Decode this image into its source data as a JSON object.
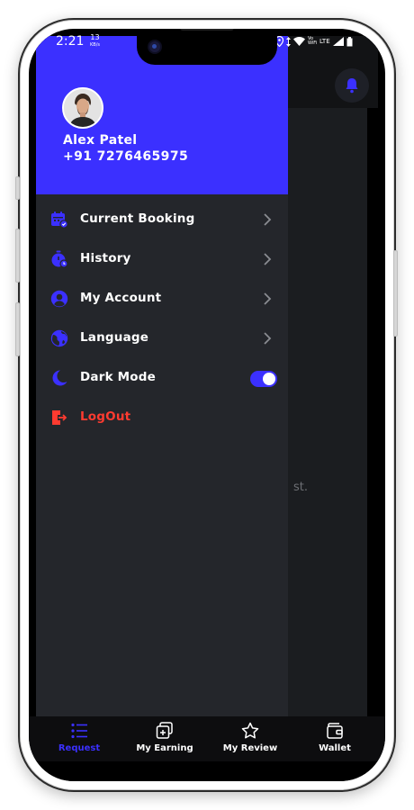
{
  "status_bar": {
    "time": "2:21",
    "net_speed": "13",
    "net_unit": "KB/s",
    "network_type": "LTE",
    "wifi_label": "Vo WiFi"
  },
  "drawer": {
    "user": {
      "name": "Alex Patel",
      "phone": "+91 7276465975"
    },
    "menu": [
      {
        "label": "Current Booking",
        "icon": "calendar-icon"
      },
      {
        "label": "History",
        "icon": "stopwatch-icon"
      },
      {
        "label": "My Account",
        "icon": "user-circle-icon"
      },
      {
        "label": "Language",
        "icon": "globe-icon"
      },
      {
        "label": "Dark Mode",
        "icon": "moon-icon",
        "toggle_on": true
      },
      {
        "label": "LogOut",
        "icon": "logout-icon"
      }
    ]
  },
  "background_screen": {
    "partial_text": "st."
  },
  "bottom_nav": {
    "items": [
      {
        "label": "Request",
        "icon": "list-icon",
        "active": true
      },
      {
        "label": "My Earning",
        "icon": "cards-icon"
      },
      {
        "label": "My Review",
        "icon": "star-icon"
      },
      {
        "label": "Wallet",
        "icon": "wallet-icon"
      }
    ]
  },
  "colors": {
    "accent": "#3b30ff",
    "drawer_bg": "#24262b",
    "logout": "#ff3b30",
    "nav_bg": "#0d0d0f"
  }
}
